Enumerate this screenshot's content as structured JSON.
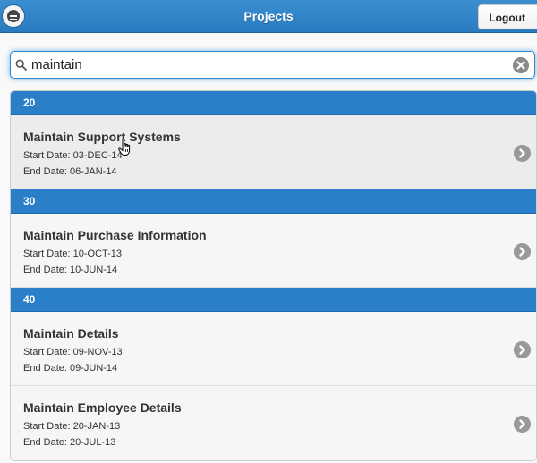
{
  "header": {
    "title": "Projects",
    "logout_label": "Logout",
    "menu_icon": "menu-icon"
  },
  "search": {
    "value": "maintain",
    "search_icon": "search-icon",
    "clear_icon": "clear-icon"
  },
  "groups": [
    {
      "label": "20",
      "items": [
        {
          "title": "Maintain Support Systems",
          "start": "Start Date: 03-DEC-14",
          "end": "End Date: 06-JAN-14"
        }
      ]
    },
    {
      "label": "30",
      "items": [
        {
          "title": "Maintain Purchase Information",
          "start": "Start Date: 10-OCT-13",
          "end": "End Date: 10-JUN-14"
        }
      ]
    },
    {
      "label": "40",
      "items": [
        {
          "title": "Maintain Details",
          "start": "Start Date: 09-NOV-13",
          "end": "End Date: 09-JUN-14"
        },
        {
          "title": "Maintain Employee Details",
          "start": "Start Date: 20-JAN-13",
          "end": "End Date: 20-JUL-13"
        }
      ]
    }
  ],
  "colors": {
    "header": "#2a7abf",
    "divider": "#2a7fc8",
    "focus": "#3388cc"
  }
}
